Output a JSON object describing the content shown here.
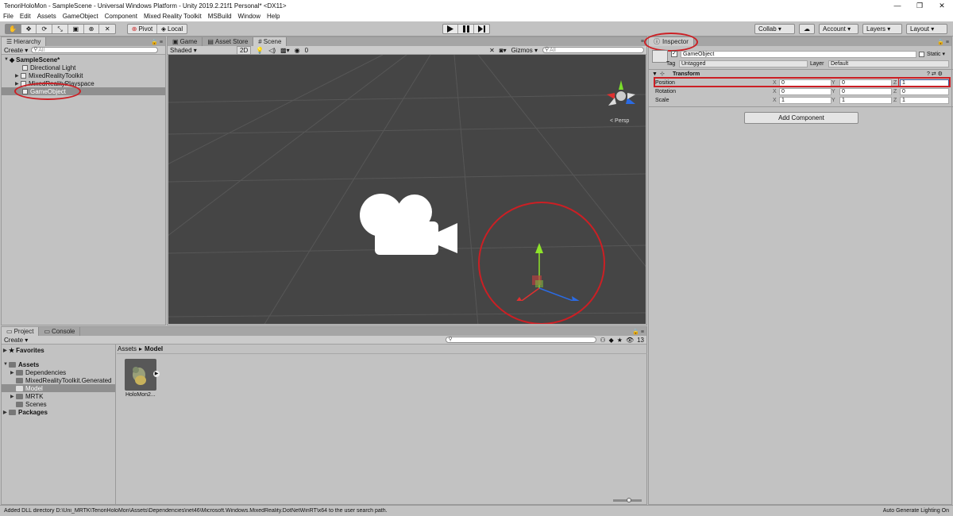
{
  "window": {
    "title": "TenoriHoloMon - SampleScene - Universal Windows Platform - Unity 2019.2.21f1 Personal* <DX11>",
    "minimize": "—",
    "maximize": "❐",
    "close": "✕"
  },
  "menu": [
    "File",
    "Edit",
    "Assets",
    "GameObject",
    "Component",
    "Mixed Reality Toolkit",
    "MSBuild",
    "Window",
    "Help"
  ],
  "toolbar": {
    "tools": [
      "✋",
      "✥",
      "⟳",
      "⤡",
      "▣",
      "⊕",
      "✕"
    ],
    "pivot": "Pivot",
    "local": "Local",
    "collab": "Collab ▾",
    "account": "Account ▾",
    "layers": "Layers ▾",
    "layout": "Layout ▾",
    "cloud_icon": "cloud-icon"
  },
  "hierarchy": {
    "tab": "Hierarchy",
    "create": "Create ▾",
    "search_placeholder": "All",
    "scene": "SampleScene*",
    "items": [
      "Directional Light",
      "MixedRealityToolkit",
      "MixedRealityPlayspace",
      "GameObject"
    ]
  },
  "sceneTabs": {
    "tabs": [
      "Game",
      "Asset Store",
      "Scene"
    ],
    "shading": "Shaded ▾",
    "mode2d": "2D",
    "gizmos": "Gizmos ▾",
    "search_placeholder": "All",
    "persp": "< Persp",
    "counter": "0"
  },
  "inspector": {
    "tab": "Inspector",
    "object_name": "GameObject",
    "static_label": "Static ▾",
    "tag_label": "Tag",
    "tag_value": "Untagged",
    "layer_label": "Layer",
    "layer_value": "Default",
    "component": "Transform",
    "rows": [
      {
        "label": "Position",
        "x": "0",
        "y": "0",
        "z": "1"
      },
      {
        "label": "Rotation",
        "x": "0",
        "y": "0",
        "z": "0"
      },
      {
        "label": "Scale",
        "x": "1",
        "y": "1",
        "z": "1"
      }
    ],
    "axis": [
      "X",
      "Y",
      "Z"
    ],
    "add_component": "Add Component"
  },
  "project": {
    "tabs": [
      "Project",
      "Console"
    ],
    "create": "Create ▾",
    "favorites": "Favorites",
    "assets": "Assets",
    "folders": [
      "Dependencies",
      "MixedRealityToolkit.Generated",
      "Model",
      "MRTK",
      "Scenes"
    ],
    "packages": "Packages",
    "breadcrumb_root": "Assets",
    "breadcrumb_sep": "▸",
    "breadcrumb_leaf": "Model",
    "asset_name": "HoloMon2...",
    "count": "13"
  },
  "status": {
    "message": "Added DLL directory D:\\Uni_MRTK\\TenoriHoloMon\\Assets\\Dependencies\\net46\\Microsoft.Windows.MixedReality.DotNetWinRT\\x64 to the user search path.",
    "right": "Auto Generate Lighting On"
  },
  "colors": {
    "highlight": "#cc1f24",
    "scene_bg": "#454545",
    "selected_row": "#8f8f8f"
  }
}
